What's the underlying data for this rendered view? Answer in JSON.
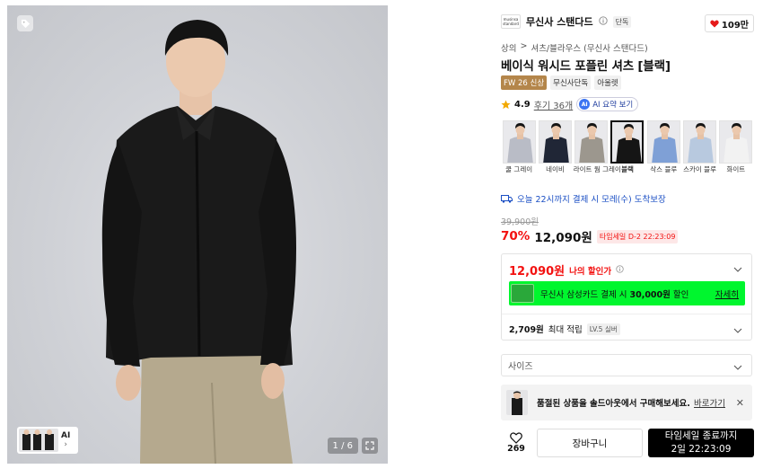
{
  "gallery": {
    "page_counter": "1 / 6",
    "thumb_label": "AI",
    "thumb_chevron": "›"
  },
  "brand": {
    "logo_text": "musinsa standard",
    "name": "무신사 스탠다드",
    "badge": "단독",
    "like_count": "109만"
  },
  "breadcrumb": {
    "items": [
      "상의",
      "셔츠/블라우스 (무신사 스탠다드)"
    ],
    "separator": ">"
  },
  "product": {
    "title": "베이식 워시드 포플린 셔츠 [블랙]",
    "tags": [
      "FW 26 신상",
      "무신사단독",
      "아울렛"
    ]
  },
  "rating": {
    "score": "4.9",
    "review_label": "후기 36개",
    "ai_label": "AI 요약 보기",
    "ai_badge": "AI"
  },
  "colors": [
    {
      "name": "쿨 그레이",
      "hex": "#b9bcc6",
      "selected": false
    },
    {
      "name": "네이비",
      "hex": "#202636",
      "selected": false
    },
    {
      "name": "라이트 웜 그레이",
      "hex": "#9c978e",
      "selected": false
    },
    {
      "name": "블랙",
      "hex": "#151515",
      "selected": true
    },
    {
      "name": "삭스 블루",
      "hex": "#7fa0d6",
      "selected": false
    },
    {
      "name": "스카이 블루",
      "hex": "#b8c9df",
      "selected": false
    },
    {
      "name": "화이트",
      "hex": "#f2f2f2",
      "selected": false
    }
  ],
  "delivery": {
    "text": "오늘 22시까지 결제 시 모레(수) 도착보장"
  },
  "price": {
    "original": "39,900원",
    "discount": "70%",
    "sale": "12,090원",
    "timesale_badge": "타임세일 D-2 22:23:09"
  },
  "benefit": {
    "my_price": "12,090원",
    "my_price_label": "나의 할인가",
    "card_text_prefix": "무신사 삼성카드 결제 시 ",
    "card_text_amount": "30,000원",
    "card_text_suffix": " 할인",
    "card_detail": "자세히",
    "points_amount": "2,709원",
    "points_label": "최대 적립",
    "level": "LV.5 실버"
  },
  "size": {
    "placeholder": "사이즈"
  },
  "soldout": {
    "text": "품절된 상품을 솔드아웃에서 구매해보세요.",
    "link": "바로가기",
    "close": "✕"
  },
  "bottom": {
    "wish_count": "269",
    "cart_label": "장바구니",
    "buy_line1": "타임세일 종료까지",
    "buy_line2": "2일 22:23:09"
  },
  "accent_colors": {
    "red": "#f31110",
    "green_banner": "#00f62e",
    "blue_text": "#1b4fc4",
    "tag_gold": "#b4864b"
  }
}
